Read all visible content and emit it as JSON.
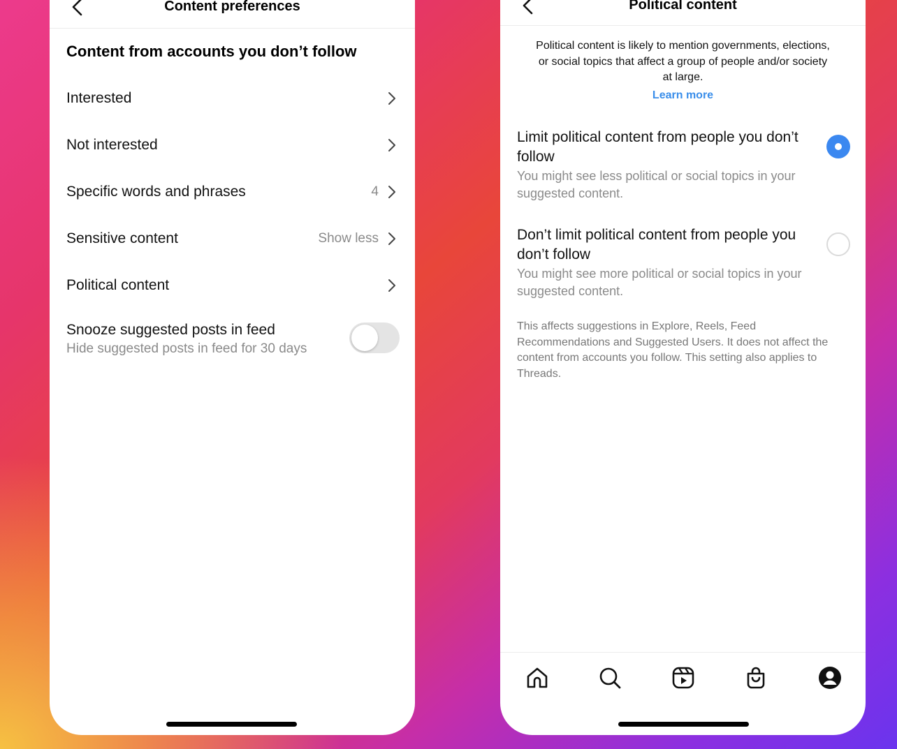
{
  "left_screen": {
    "title": "Content preferences",
    "section_heading": "Content from accounts you don’t follow",
    "rows": [
      {
        "label": "Interested",
        "value": ""
      },
      {
        "label": "Not interested",
        "value": ""
      },
      {
        "label": "Specific words and phrases",
        "value": "4"
      },
      {
        "label": "Sensitive content",
        "value": "Show less"
      },
      {
        "label": "Political content",
        "value": ""
      }
    ],
    "snooze": {
      "title": "Snooze suggested posts in feed",
      "subtitle": "Hide suggested posts in feed for 30 days",
      "enabled": false
    }
  },
  "right_screen": {
    "title": "Political content",
    "description": "Political content is likely to mention governments, elections, or social topics that affect a group of people and/or society at large.",
    "learn_more": "Learn more",
    "options": [
      {
        "title": "Limit political content from people you don’t follow",
        "subtitle": "You might see less political or social topics in your suggested content.",
        "selected": true
      },
      {
        "title": "Don’t limit political content from people you don’t follow",
        "subtitle": "You might see more political or social topics in your suggested content.",
        "selected": false
      }
    ],
    "footnote": "This affects suggestions in Explore, Reels, Feed Recommendations and Suggested Users. It does not affect the content from accounts you follow. This setting also applies to Threads.",
    "tabs": [
      "home-icon",
      "search-icon",
      "reels-icon",
      "shop-icon",
      "profile-icon"
    ]
  },
  "colors": {
    "accent_blue": "#3b88f0",
    "link_blue": "#3a8eea",
    "secondary_text": "#8a8a8a"
  }
}
